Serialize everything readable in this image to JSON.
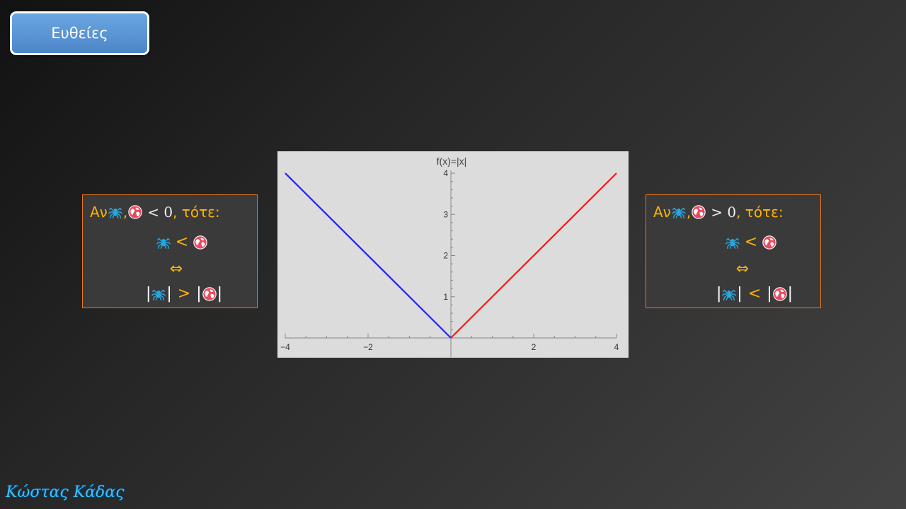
{
  "nav_button": {
    "label": "Ευθείες"
  },
  "left_rule": {
    "prefix": "Αν ",
    "comma": ",",
    "relation": "< 0",
    "suffix": ", τότε:",
    "line2_op": "<",
    "iff": "⇔",
    "line4_op": ">",
    "bar": "|"
  },
  "right_rule": {
    "prefix": "Αν ",
    "comma": ",",
    "relation": "> 0",
    "suffix": ", τότε:",
    "line2_op": "<",
    "iff": "⇔",
    "line4_op": "<",
    "bar": "|"
  },
  "icons": {
    "a": "spider-icon",
    "b": "globe-icon"
  },
  "colors": {
    "accent": "#ffb300",
    "button": "#5a96d6",
    "box_border": "#e87722",
    "negative_branch": "#1f1fff",
    "positive_branch": "#ff1515"
  },
  "author": "Κώστας Κάδας",
  "chart_data": {
    "type": "line",
    "title": "f(x)=|x|",
    "xlim": [
      -4,
      4
    ],
    "ylim": [
      0,
      4
    ],
    "x_ticks": [
      -4,
      -2,
      2,
      4
    ],
    "x_tick_labels": [
      "−4",
      "−2",
      "2",
      "4"
    ],
    "y_ticks": [
      1,
      2,
      3,
      4
    ],
    "y_tick_labels": [
      "1",
      "2",
      "3",
      "4"
    ],
    "series": [
      {
        "color": "#1f1fff",
        "x": [
          -4,
          0
        ],
        "y": [
          4,
          0
        ]
      },
      {
        "color": "#ff1515",
        "x": [
          0,
          4
        ],
        "y": [
          0,
          4
        ]
      }
    ]
  }
}
